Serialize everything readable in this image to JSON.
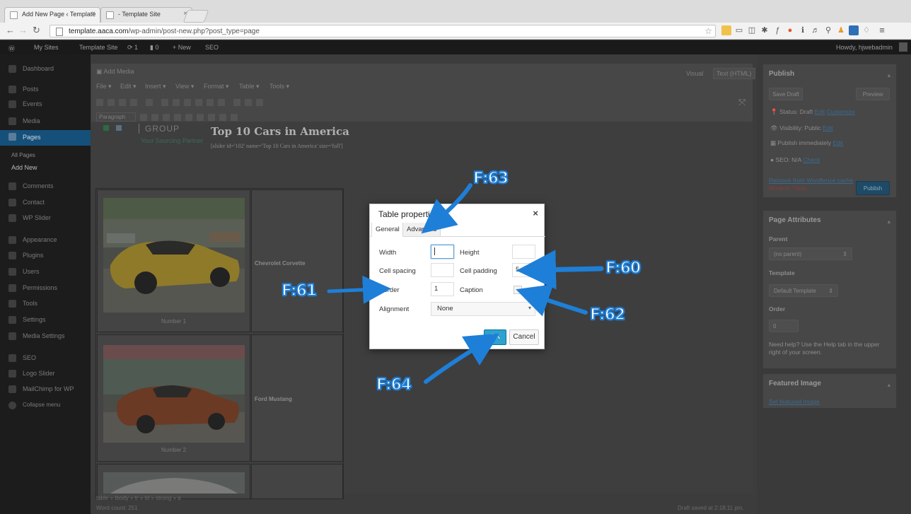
{
  "browser": {
    "tabs": [
      {
        "label": "Add New Page ‹ Template"
      },
      {
        "label": "- Template Site"
      }
    ],
    "url_host": "template.aaca.com",
    "url_path": "/wp-admin/post-new.php?post_type=page"
  },
  "adminbar": {
    "my_sites": "My Sites",
    "site": "Template Site",
    "updates": "1",
    "comments": "0",
    "new": "+ New",
    "seo": "SEO",
    "howdy": "Howdy, hjwebadmin"
  },
  "sidebar": {
    "items": [
      {
        "label": "Dashboard"
      },
      {
        "label": "Posts"
      },
      {
        "label": "Events"
      },
      {
        "label": "Media"
      },
      {
        "label": "Pages"
      },
      {
        "label": "All Pages"
      },
      {
        "label": "Add New"
      },
      {
        "label": "Comments"
      },
      {
        "label": "Contact"
      },
      {
        "label": "WP Slider"
      },
      {
        "label": "Appearance"
      },
      {
        "label": "Plugins"
      },
      {
        "label": "Users"
      },
      {
        "label": "Permissions"
      },
      {
        "label": "Tools"
      },
      {
        "label": "Settings"
      },
      {
        "label": "Media Settings"
      },
      {
        "label": "SEO"
      },
      {
        "label": "Logo Slider"
      },
      {
        "label": "MailChimp for WP"
      },
      {
        "label": "Collapse menu"
      }
    ]
  },
  "editor": {
    "add_media": "Add Media",
    "visual_tab": "Visual",
    "text_tab": "Text (HTML)",
    "menus": [
      "File",
      "Edit",
      "Insert",
      "View",
      "Format",
      "Table",
      "Tools"
    ],
    "paragraph": "Paragraph",
    "logo_text": "GROUP",
    "logo_sub": "Your Sourcing Partner",
    "heading": "Top 10 Cars in America",
    "shortcode": "[slider id='102' name='Top 10 Cars in America' size='full']",
    "rows": [
      {
        "car": "Chevrolet Corvette",
        "caption": "Number 1"
      },
      {
        "car": "Ford Mustang",
        "caption": "Number 2"
      }
    ],
    "path": "table » tbody » tr » td » strong » a",
    "word_count": "Word count: 251",
    "draft_saved": "Draft saved at 2:18:11 pm."
  },
  "publish_box": {
    "title": "Publish",
    "save_draft": "Save Draft",
    "preview": "Preview",
    "status": "Status: Draft",
    "status_edit": "Edit",
    "status_customize": "Customize",
    "visibility": "Visibility: Public",
    "visibility_edit": "Edit",
    "publish_time": "Publish immediately",
    "publish_edit": "Edit",
    "seo": "SEO: N/A",
    "seo_check": "Check",
    "remove_cache": "Remove from Wordfence cache",
    "trash": "Move to Trash",
    "publish": "Publish"
  },
  "attributes_box": {
    "title": "Page Attributes",
    "parent_label": "Parent",
    "parent_value": "(no parent)",
    "template_label": "Template",
    "template_value": "Default Template",
    "order_label": "Order",
    "order_value": "0",
    "help": "Need help? Use the Help tab in the upper right of your screen."
  },
  "featured_box": {
    "title": "Featured Image",
    "link": "Set featured image"
  },
  "dialog": {
    "title": "Table properties",
    "tab_general": "General",
    "tab_advanced": "Advanced",
    "width_label": "Width",
    "width_value": "",
    "height_label": "Height",
    "height_value": "",
    "cellspacing_label": "Cell spacing",
    "cellspacing_value": "",
    "cellpadding_label": "Cell padding",
    "cellpadding_value": "5",
    "border_label": "Border",
    "border_value": "1",
    "caption_label": "Caption",
    "alignment_label": "Alignment",
    "alignment_value": "None",
    "ok": "OK",
    "cancel": "Cancel"
  },
  "annotations": {
    "f63": "F:63",
    "f60": "F:60",
    "f61": "F:61",
    "f62": "F:62",
    "f64": "F:64",
    "color": "#1e7fd8"
  }
}
